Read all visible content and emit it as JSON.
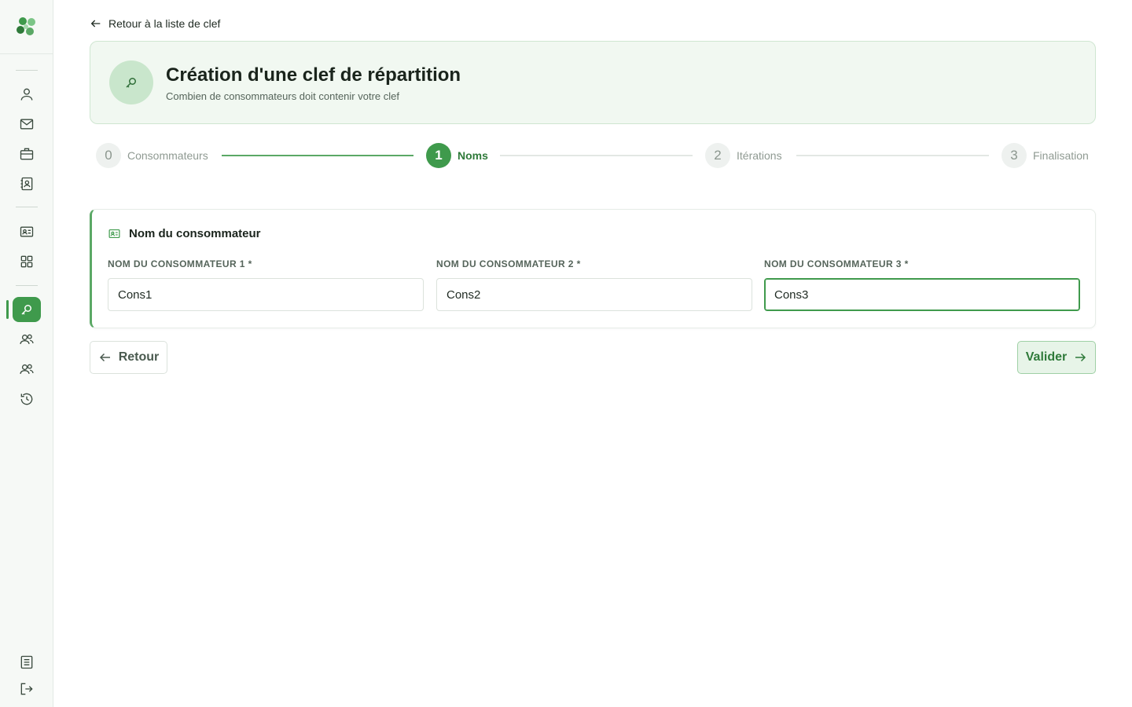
{
  "sidebar": {
    "top_icons": [
      "user-icon",
      "mail-icon",
      "briefcase-icon",
      "contact-book-icon"
    ],
    "mid_icons": [
      "id-card-icon",
      "grid-icon"
    ],
    "lower_icons": [
      "key-icon",
      "users-icon",
      "group-icon",
      "history-icon"
    ],
    "bottom_icons": [
      "document-icon",
      "logout-icon"
    ],
    "active": "key-icon",
    "accent_color": "#3f9a4c"
  },
  "back_link": {
    "label": "Retour à la liste de clef"
  },
  "header": {
    "title": "Création d'une clef de répartition",
    "subtitle": "Combien de consommateurs doit contenir votre clef"
  },
  "stepper": {
    "steps": [
      {
        "number": "0",
        "label": "Consommateurs"
      },
      {
        "number": "1",
        "label": "Noms"
      },
      {
        "number": "2",
        "label": "Itérations"
      },
      {
        "number": "3",
        "label": "Finalisation"
      }
    ],
    "active_index": 1
  },
  "form": {
    "title": "Nom du consommateur",
    "fields": [
      {
        "label": "NOM DU CONSOMMATEUR 1 *",
        "value": "Cons1"
      },
      {
        "label": "NOM DU CONSOMMATEUR 2 *",
        "value": "Cons2"
      },
      {
        "label": "NOM DU CONSOMMATEUR 3 *",
        "value": "Cons3"
      }
    ]
  },
  "actions": {
    "back_label": "Retour",
    "next_label": "Valider"
  }
}
